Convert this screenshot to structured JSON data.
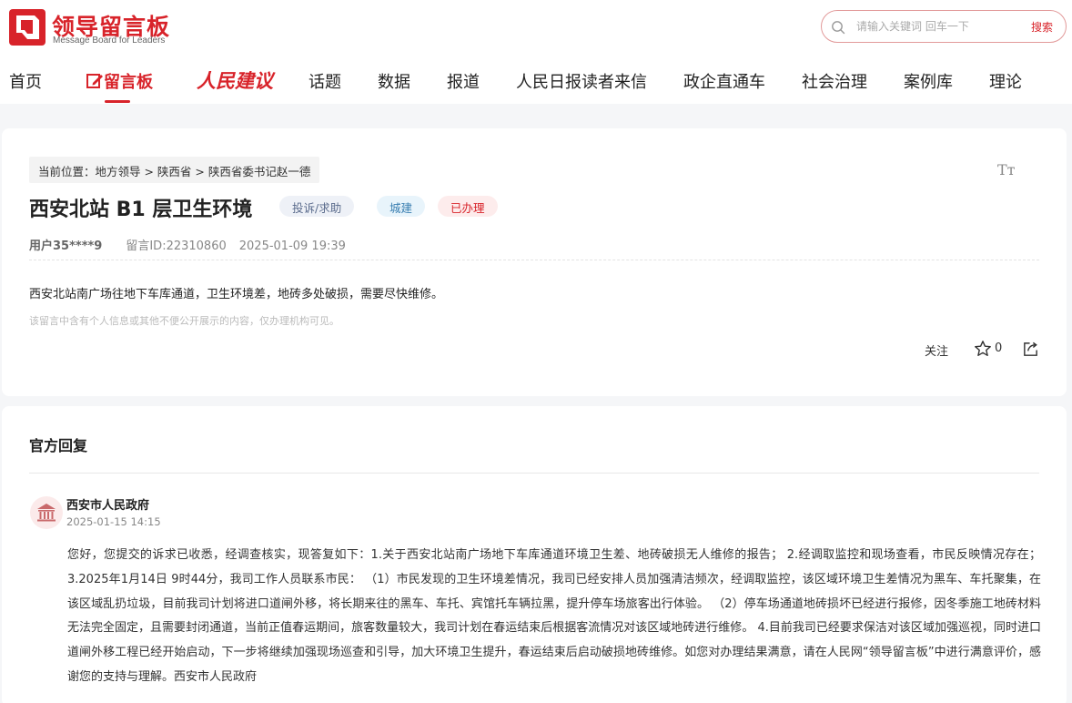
{
  "header": {
    "logo_title": "领导留言板",
    "logo_subtitle": "Message Board for Leaders",
    "search_placeholder": "请输入关键词 回车一下",
    "search_button": "搜索"
  },
  "nav": {
    "items": [
      {
        "label": "首页"
      },
      {
        "label": "留言板"
      },
      {
        "label": "人民建议"
      },
      {
        "label": "话题"
      },
      {
        "label": "数据"
      },
      {
        "label": "报道"
      },
      {
        "label": "人民日报读者来信"
      },
      {
        "label": "政企直通车"
      },
      {
        "label": "社会治理"
      },
      {
        "label": "案例库"
      },
      {
        "label": "理论"
      }
    ]
  },
  "message": {
    "breadcrumb": "当前位置：地方领导 > 陕西省 > 陕西省委书记赵一德",
    "font_size_icon": "Tт",
    "title": "西安北站 B1 层卫生环境",
    "tags": [
      "投诉/求助",
      "城建",
      "已办理"
    ],
    "user": "用户35****9",
    "message_id": "留言ID:22310860",
    "date": "2025-01-09 19:39",
    "content": "西安北站南广场往地下车库通道，卫生环境差，地砖多处破损，需要尽快维修。",
    "privacy_note": "该留言中含有个人信息或其他不便公开展示的内容，仅办理机构可见。",
    "follow_label": "关注",
    "star_count": "0"
  },
  "reply": {
    "heading": "官方回复",
    "org_name": "西安市人民政府",
    "time": "2025-01-15 14:15",
    "text": "您好，您提交的诉求已收悉，经调查核实，现答复如下：1.关于西安北站南广场地下车库通道环境卫生差、地砖破损无人维修的报告； 2.经调取监控和现场查看，市民反映情况存在； 3.2025年1月14日 9时44分，我司工作人员联系市民： （1）市民发现的卫生环境差情况，我司已经安排人员加强清洁频次，经调取监控，该区域环境卫生差情况为黑车、车托聚集，在该区域乱扔垃圾，目前我司计划将进口道闸外移，将长期来往的黑车、车托、宾馆托车辆拉黑，提升停车场旅客出行体验。 （2）停车场通道地砖损坏已经进行报修，因冬季施工地砖材料无法完全固定，且需要封闭通道，当前正值春运期间，旅客数量较大，我司计划在春运结束后根据客流情况对该区域地砖进行维修。 4.目前我司已经要求保洁对该区域加强巡视，同时进口道闸外移工程已经开始启动，下一步将继续加强现场巡查和引导，加大环境卫生提升，春运结束后启动破损地砖维修。如您对办理结果满意，请在人民网“领导留言板”中进行满意评价，感谢您的支持与理解。西安市人民政府"
  },
  "colors": {
    "brand": "#d8232a",
    "tag_type": "#5a6b8c",
    "tag_category": "#3a7fb1",
    "tag_status": "#d8232a"
  }
}
